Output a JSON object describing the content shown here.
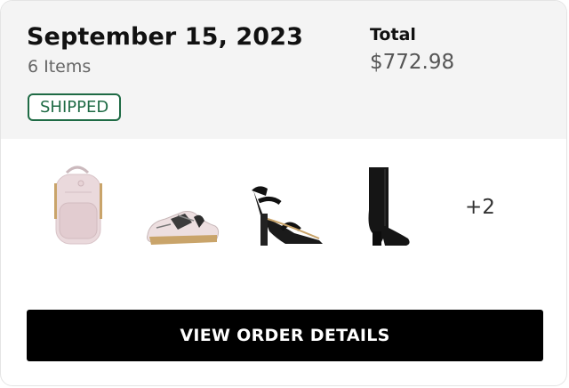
{
  "order": {
    "date": "September 15, 2023",
    "item_count": "6 Items",
    "status": "SHIPPED",
    "total_label": "Total",
    "total_value": "$772.98"
  },
  "products": [
    {
      "icon": "backpack-icon"
    },
    {
      "icon": "sneaker-icon"
    },
    {
      "icon": "sandal-icon"
    },
    {
      "icon": "boot-icon"
    }
  ],
  "more_items": "+2",
  "cta": {
    "label": "VIEW ORDER DETAILS"
  },
  "colors": {
    "status_green": "#1f6b45",
    "header_bg": "#f4f4f4",
    "button_bg": "#000000"
  }
}
